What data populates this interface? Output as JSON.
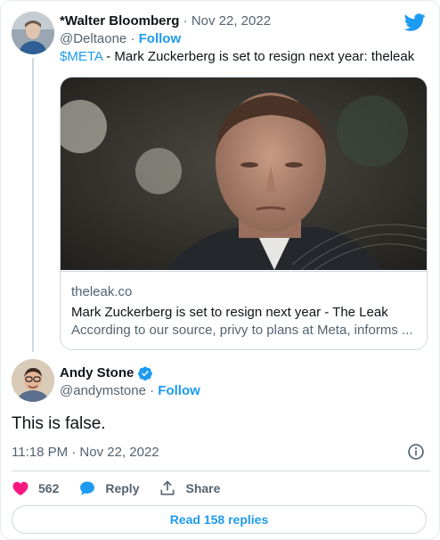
{
  "quoted_tweet": {
    "author_name": "*Walter Bloomberg",
    "separator": "·",
    "date": "Nov 22, 2022",
    "handle": "@Deltaone",
    "follow_label": "Follow",
    "cashtag": "$META",
    "text": " - Mark Zuckerberg is set to resign next year: theleak",
    "link_card": {
      "domain": "theleak.co",
      "title": "Mark Zuckerberg is set to resign next year - The Leak",
      "description": "According to our source, privy to plans at Meta, informs ..."
    }
  },
  "tweet": {
    "author_name": "Andy Stone",
    "handle": "@andymstone",
    "follow_label": "Follow",
    "text": "This is false.",
    "timestamp": "11:18 PM · Nov 22, 2022",
    "actions": {
      "like_count": "562",
      "reply_label": "Reply",
      "share_label": "Share"
    },
    "read_replies_label": "Read 158 replies"
  },
  "colors": {
    "accent": "#1d9bf0",
    "like": "#f91880",
    "muted": "#536471",
    "border": "#cfd9de"
  },
  "icons": {
    "brand": "twitter-bird-icon",
    "verified": "verified-badge-icon",
    "info": "info-icon",
    "like": "heart-icon",
    "reply": "speech-bubble-icon",
    "share": "share-upload-icon"
  }
}
